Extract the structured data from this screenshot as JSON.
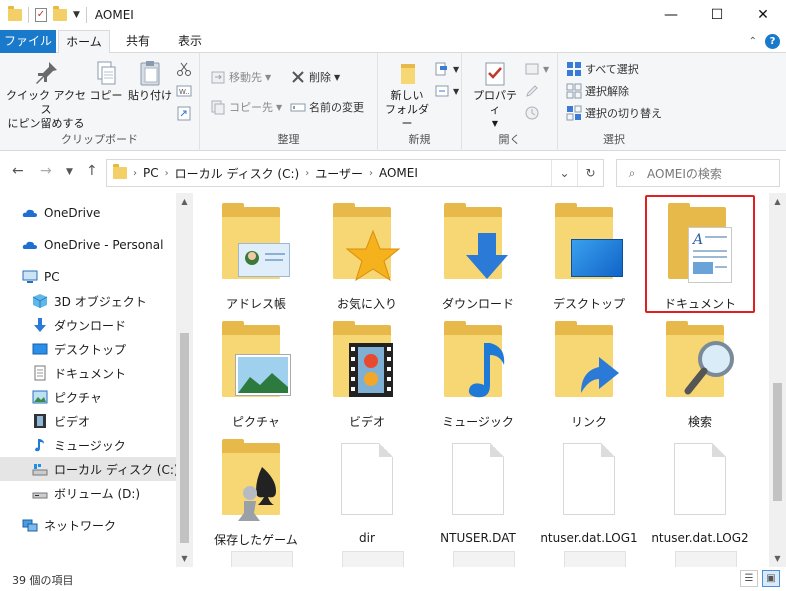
{
  "window": {
    "title": "AOMEI",
    "controls": {
      "minimize": "—",
      "maximize": "☐",
      "close": "✕"
    }
  },
  "tabs": {
    "file": "ファイル",
    "home": "ホーム",
    "share": "共有",
    "view": "表示"
  },
  "ribbon": {
    "clipboard": {
      "label": "クリップボード",
      "pin_line1": "クイック アクセス",
      "pin_line2": "にピン留めする",
      "copy": "コピー",
      "paste": "貼り付け"
    },
    "organize": {
      "label": "整理",
      "move_to": "移動先",
      "copy_to": "コピー先",
      "delete": "削除",
      "rename": "名前の変更"
    },
    "new": {
      "label": "新規",
      "new_folder_line1": "新しい",
      "new_folder_line2": "フォルダー"
    },
    "open": {
      "label": "開く",
      "properties": "プロパティ"
    },
    "select": {
      "label": "選択",
      "select_all": "すべて選択",
      "select_none": "選択解除",
      "invert": "選択の切り替え"
    }
  },
  "address": {
    "crumbs": [
      "PC",
      "ローカル ディスク (C:)",
      "ユーザー",
      "AOMEI"
    ],
    "search_placeholder": "AOMEIの検索"
  },
  "sidebar": {
    "items": [
      {
        "label": "OneDrive",
        "icon": "cloud-icon"
      },
      {
        "label": "OneDrive - Personal",
        "icon": "cloud-icon"
      },
      {
        "label": "PC",
        "icon": "pc-icon"
      },
      {
        "label": "3D オブジェクト",
        "icon": "cube-icon"
      },
      {
        "label": "ダウンロード",
        "icon": "download-icon"
      },
      {
        "label": "デスクトップ",
        "icon": "desktop-icon"
      },
      {
        "label": "ドキュメント",
        "icon": "document-icon"
      },
      {
        "label": "ピクチャ",
        "icon": "picture-icon"
      },
      {
        "label": "ビデオ",
        "icon": "video-icon"
      },
      {
        "label": "ミュージック",
        "icon": "music-icon"
      },
      {
        "label": "ローカル ディスク (C:)",
        "icon": "drive-icon"
      },
      {
        "label": "ボリューム (D:)",
        "icon": "drive-icon"
      },
      {
        "label": "ネットワーク",
        "icon": "network-icon"
      }
    ]
  },
  "files": [
    {
      "name": "アドレス帳",
      "kind": "contacts"
    },
    {
      "name": "お気に入り",
      "kind": "favorites"
    },
    {
      "name": "ダウンロード",
      "kind": "downloads"
    },
    {
      "name": "デスクトップ",
      "kind": "desktop"
    },
    {
      "name": "ドキュメント",
      "kind": "documents"
    },
    {
      "name": "ピクチャ",
      "kind": "pictures"
    },
    {
      "name": "ビデオ",
      "kind": "videos"
    },
    {
      "name": "ミュージック",
      "kind": "music"
    },
    {
      "name": "リンク",
      "kind": "links"
    },
    {
      "name": "検索",
      "kind": "search"
    },
    {
      "name": "保存したゲーム",
      "kind": "games"
    },
    {
      "name": "dir",
      "kind": "file"
    },
    {
      "name": "NTUSER.DAT",
      "kind": "file"
    },
    {
      "name": "ntuser.dat.LOG1",
      "kind": "file"
    },
    {
      "name": "ntuser.dat.LOG2",
      "kind": "file"
    }
  ],
  "status": {
    "item_count": "39 個の項目"
  },
  "colors": {
    "accent": "#1979ca",
    "highlight_border": "#e02020",
    "folder": "#f7d774"
  }
}
